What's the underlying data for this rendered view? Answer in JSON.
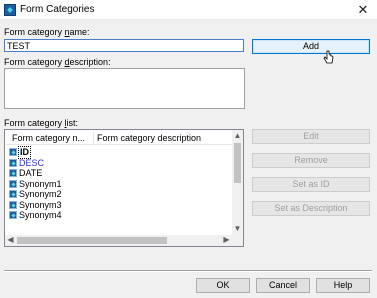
{
  "window": {
    "title": "Form Categories",
    "close_glyph": "✕"
  },
  "form": {
    "name_label_pre": "Form category ",
    "name_label_key": "n",
    "name_label_post": "ame:",
    "name_value": "TEST",
    "desc_label_pre": "Form category ",
    "desc_label_key": "d",
    "desc_label_post": "escription:",
    "list_label_pre": "Form category ",
    "list_label_key": "l",
    "list_label_post": "ist:"
  },
  "list": {
    "columns": [
      "Form category n...",
      "Form category description"
    ],
    "rows": [
      {
        "name": "ID",
        "bold": true,
        "color": "#000000"
      },
      {
        "name": "DESC",
        "bold": false,
        "color": "#2b2bd6"
      },
      {
        "name": "DATE",
        "bold": false,
        "color": "#000000"
      },
      {
        "name": "Synonym1",
        "bold": false,
        "color": "#000000"
      },
      {
        "name": "Synonym2",
        "bold": false,
        "color": "#000000"
      },
      {
        "name": "Synonym3",
        "bold": false,
        "color": "#000000"
      },
      {
        "name": "Synonym4",
        "bold": false,
        "color": "#000000"
      }
    ],
    "scroll_up": "▲",
    "scroll_down": "▼",
    "scroll_left": "◀",
    "scroll_right": "▶"
  },
  "buttons": {
    "add": "Add",
    "edit": "Edit",
    "remove": "Remove",
    "set_as_id": "Set as ID",
    "set_as_description": "Set as Description",
    "ok": "OK",
    "cancel": "Cancel",
    "help": "Help"
  }
}
